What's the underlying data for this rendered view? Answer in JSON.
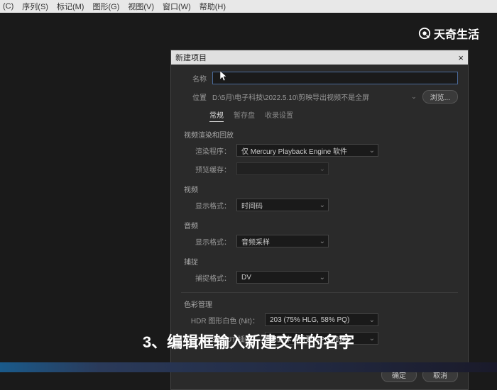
{
  "menu": {
    "items": [
      "(C)",
      "序列(S)",
      "标记(M)",
      "图形(G)",
      "视图(V)",
      "窗口(W)",
      "帮助(H)"
    ]
  },
  "watermark": "天奇生活",
  "dialog": {
    "title": "新建项目",
    "name_label": "名称",
    "name_value": "",
    "location_label": "位置",
    "location_value": "D:\\5月\\电子科技\\2022.5.10\\剪映导出视频不是全屏",
    "browse": "浏览...",
    "tabs": [
      "常规",
      "暂存盘",
      "收录设置"
    ],
    "sec_render": "视频渲染和回放",
    "renderer_label": "渲染程序：",
    "renderer_value": "仅 Mercury Playback Engine 软件",
    "preview_cache_label": "预览缓存：",
    "sec_video": "视频",
    "display_format_label": "显示格式：",
    "video_format_value": "时间码",
    "sec_audio": "音频",
    "audio_format_value": "音频采样",
    "sec_capture": "捕捉",
    "capture_format_label": "捕捉格式：",
    "capture_format_value": "DV",
    "sec_color": "色彩管理",
    "hdr_label": "HDR 图形白色 (Nit)：",
    "hdr_value": "203 (75% HLG, 58% PQ)",
    "lut_label": "3D LUT 插值：",
    "lut_value": "四面体（需要 GPU 加速）",
    "ok": "确定",
    "cancel": "取消"
  },
  "caption": "3、编辑框输入新建文件的名字"
}
